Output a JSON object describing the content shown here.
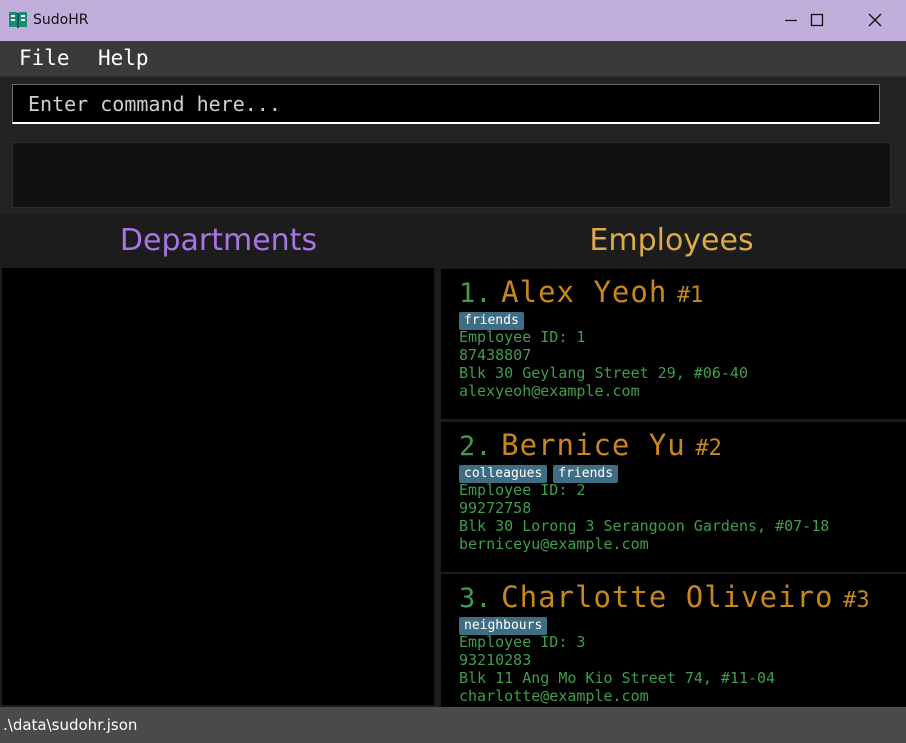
{
  "window": {
    "title": "SudoHR"
  },
  "menu": {
    "file": "File",
    "help": "Help"
  },
  "command": {
    "placeholder": "Enter command here...",
    "value": ""
  },
  "result": {
    "text": ""
  },
  "departments": {
    "header": "Departments"
  },
  "employees": {
    "header": "Employees",
    "cards": [
      {
        "index": "1.",
        "name": "Alex Yeoh",
        "id_badge": "#1",
        "tags": [
          "friends"
        ],
        "employee_id": "Employee ID: 1",
        "phone": "87438807",
        "address": "Blk 30 Geylang Street 29, #06-40",
        "email": "alexyeoh@example.com"
      },
      {
        "index": "2.",
        "name": "Bernice Yu",
        "id_badge": "#2",
        "tags": [
          "colleagues",
          "friends"
        ],
        "employee_id": "Employee ID: 2",
        "phone": "99272758",
        "address": "Blk 30 Lorong 3 Serangoon Gardens, #07-18",
        "email": "berniceyu@example.com"
      },
      {
        "index": "3.",
        "name": "Charlotte Oliveiro",
        "id_badge": "#3",
        "tags": [
          "neighbours"
        ],
        "employee_id": "Employee ID: 3",
        "phone": "93210283",
        "address": "Blk 11 Ang Mo Kio Street 74, #11-04",
        "email": "charlotte@example.com"
      }
    ]
  },
  "status": {
    "path": ".\\data\\sudohr.json"
  },
  "colors": {
    "titlebar": "#c2aedb",
    "departments_header": "#a874e6",
    "employees_header": "#dea94a",
    "employee_name": "#c8861e",
    "employee_detail": "#3f9e4c",
    "tag_bg": "#3f6e84"
  },
  "icons": {
    "app": "book-icon",
    "minimize": "minimize-icon",
    "maximize": "maximize-icon",
    "close": "close-icon"
  }
}
